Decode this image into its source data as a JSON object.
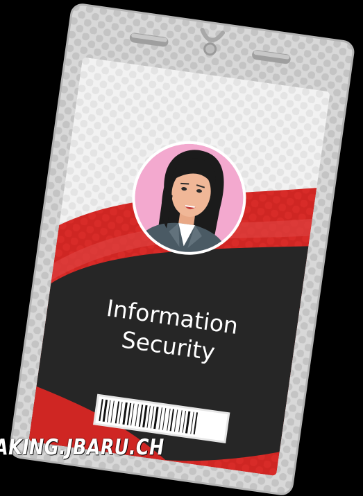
{
  "badge": {
    "title_line1": "Information",
    "title_line2": "Security"
  },
  "colors": {
    "background": "#000000",
    "holder": "#d6d6d6",
    "holder_dots": "#c2c2c2",
    "card_red": "#d12a27",
    "card_dark": "#262626",
    "avatar_bg": "#f3a9cf"
  },
  "watermark": "AKING.JBARU.CH"
}
